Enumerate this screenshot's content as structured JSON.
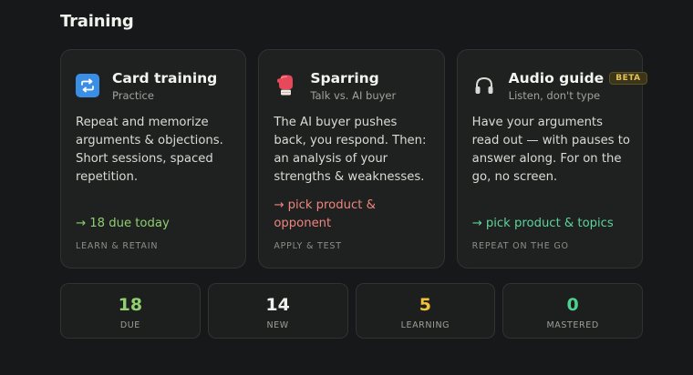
{
  "section": {
    "title": "Training"
  },
  "cards": [
    {
      "title": "Card training",
      "subtitle": "Practice",
      "icon": "repeat-icon",
      "body": "Repeat and memorize arguments & objections. Short sessions, spaced repetition.",
      "action": "→ 18 due today",
      "action_color": "#8fcf6f",
      "tag": "LEARN & RETAIN"
    },
    {
      "title": "Sparring",
      "subtitle": "Talk vs. AI buyer",
      "icon": "boxing-glove-icon",
      "body": "The AI buyer pushes back, you respond. Then: an analysis of your strengths & weaknesses.",
      "action": "→ pick product & opponent",
      "action_color": "#f0847e",
      "tag": "APPLY & TEST"
    },
    {
      "title": "Audio guide",
      "badge": "BETA",
      "subtitle": "Listen, don't type",
      "icon": "headphones-icon",
      "body": "Have your arguments read out — with pauses to answer along. For on the go, no screen.",
      "action": "→ pick product & topics",
      "action_color": "#5fd39b",
      "tag": "REPEAT ON THE GO"
    }
  ],
  "stats": [
    {
      "value": "18",
      "label": "DUE",
      "color": "#8fcf6f"
    },
    {
      "value": "14",
      "label": "NEW",
      "color": "#eef0ec"
    },
    {
      "value": "5",
      "label": "LEARNING",
      "color": "#f0c23a"
    },
    {
      "value": "0",
      "label": "MASTERED",
      "color": "#4fd08f"
    }
  ]
}
